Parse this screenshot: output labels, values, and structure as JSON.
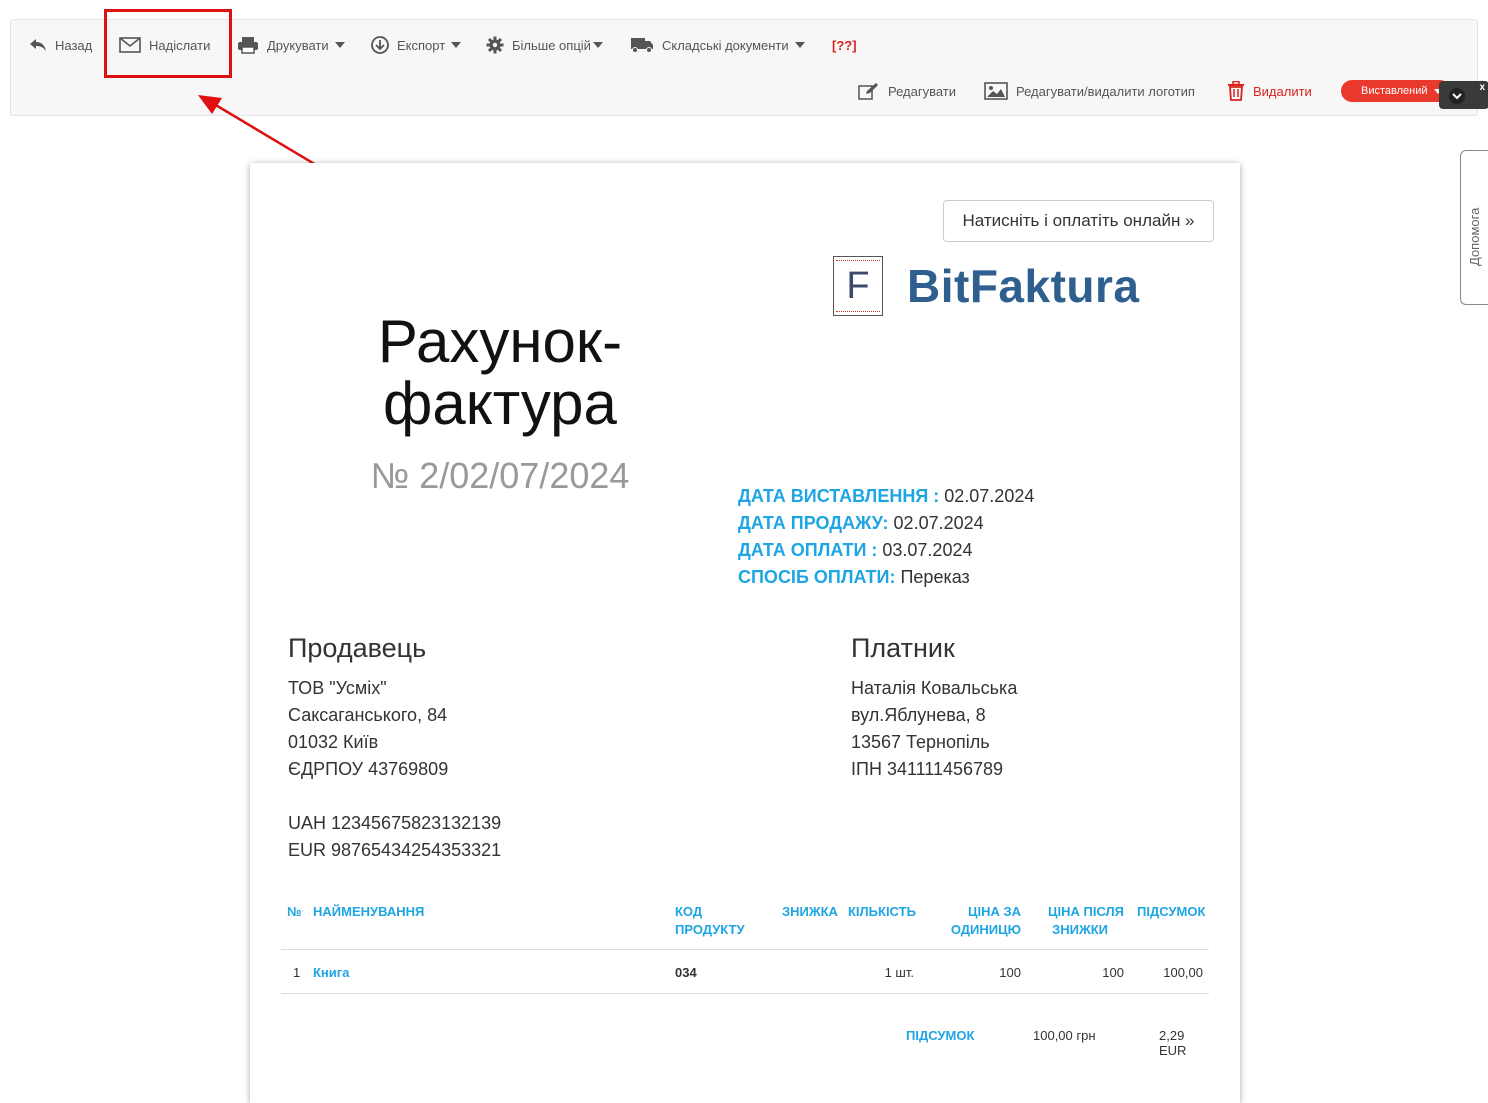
{
  "toolbar": {
    "back": "Назад",
    "send": "Надіслати",
    "print": "Друкувати",
    "export": "Експорт",
    "more": "Більше опцій",
    "warehouse": "Складські документи",
    "unknown": "[??]",
    "edit": "Редагувати",
    "edit_logo": "Редагувати/видалити логотип",
    "delete": "Видалити",
    "status": "Виставлений",
    "close": "x"
  },
  "help_tab": "Допомога",
  "document": {
    "pay_online": "Натисніть і оплатіть онлайн »",
    "logo_letter": "F",
    "logo_text": "BitFaktura",
    "title": "Рахунок-фактура",
    "number": "№ 2/02/07/2024",
    "dates": [
      {
        "label": "ДАТА ВИСТАВЛЕННЯ :",
        "value": " 02.07.2024"
      },
      {
        "label": "ДАТА ПРОДАЖУ:",
        "value": " 02.07.2024"
      },
      {
        "label": "ДАТА ОПЛАТИ :",
        "value": " 03.07.2024"
      },
      {
        "label": "СПОСІБ ОПЛАТИ:",
        "value": " Переказ"
      }
    ],
    "seller": {
      "heading": "Продавець",
      "lines": [
        "ТОВ \"Усміх\"",
        "Саксаганського, 84",
        "01032 Київ",
        "ЄДРПОУ 43769809",
        "",
        "UAH 12345675823132139",
        "EUR 98765434254353321"
      ]
    },
    "buyer": {
      "heading": "Платник",
      "lines": [
        "Наталія Ковальська",
        "вул.Яблунева, 8",
        "13567 Тернопіль",
        "ІПН 341111456789"
      ]
    },
    "table": {
      "headers": {
        "no": "№",
        "name": "НАЙМЕНУВАННЯ",
        "code_1": "КОД",
        "code_2": "ПРОДУКТУ",
        "discount": "ЗНИЖКА",
        "qty": "КІЛЬКІСТЬ",
        "price_1": "ЦІНА ЗА",
        "price_2": "ОДИНИЦЮ",
        "after_1": "ЦІНА ПІСЛЯ",
        "after_2": "ЗНИЖКИ",
        "total": "ПІДСУМОК"
      },
      "rows": [
        {
          "no": "1",
          "name": "Книга",
          "code": "034",
          "discount": "",
          "qty": "1 шт.",
          "price": "100",
          "after": "100",
          "total": "100,00"
        }
      ],
      "summary_label": "ПІДСУМОК",
      "summary_uah": "100,00 грн",
      "summary_eur": "2,29 EUR"
    }
  },
  "colors": {
    "accent": "#1ea5e3",
    "danger": "#d9231d",
    "status": "#e8392c"
  }
}
